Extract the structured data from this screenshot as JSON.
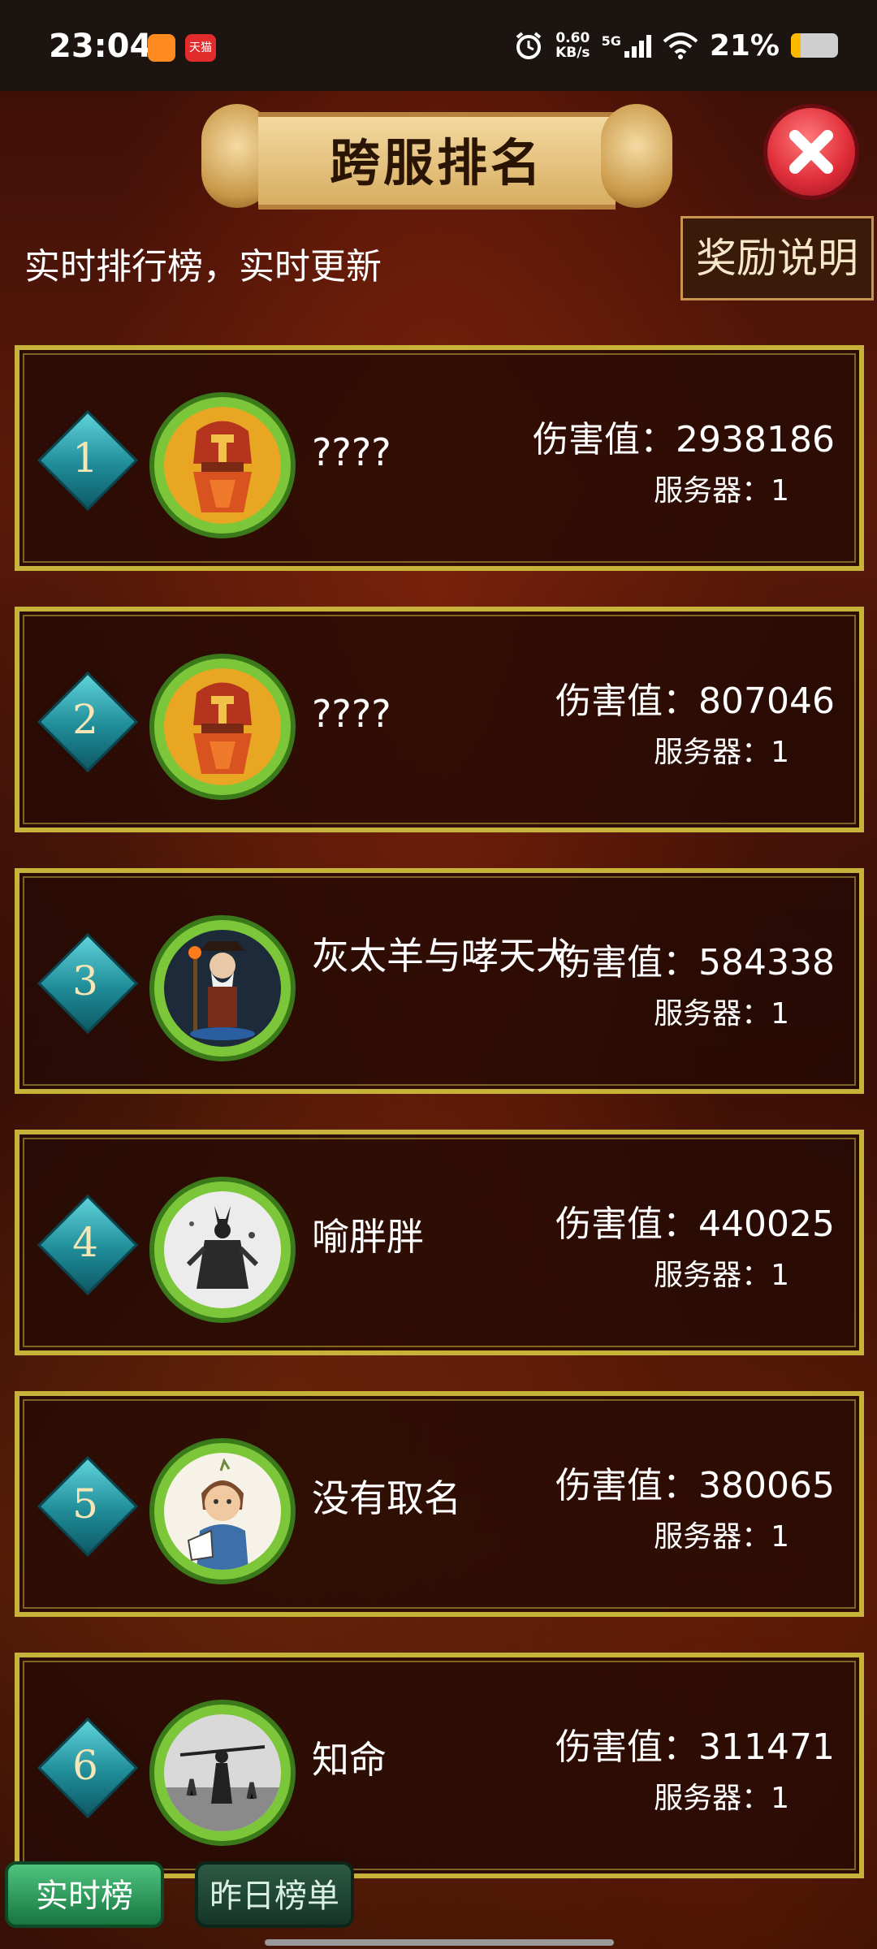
{
  "status_bar": {
    "time": "23:04",
    "app_icons": [
      "app-orange-icon",
      "天猫"
    ],
    "net_speed_top": "0.60",
    "net_speed_bottom": "KB/s",
    "network": "5G",
    "battery": "21%",
    "battery_level": 0.21
  },
  "header": {
    "title": "跨服排名",
    "subtitle": "实时排行榜，实时更新",
    "reward_button": "奖励说明"
  },
  "rows": [
    {
      "rank": "1",
      "name": "????",
      "damage_label": "伤害值：",
      "damage": "2938186",
      "server_label": "服务器：",
      "server": "1",
      "avatar": "dwarf-warrior-avatar"
    },
    {
      "rank": "2",
      "name": "????",
      "damage_label": "伤害值：",
      "damage": "807046",
      "server_label": "服务器：",
      "server": "1",
      "avatar": "dwarf-warrior-avatar"
    },
    {
      "rank": "3",
      "name": "灰太羊与哮天犬",
      "damage_label": "伤害值：",
      "damage": "584338",
      "server_label": "服务器：",
      "server": "1",
      "avatar": "wizard-avatar"
    },
    {
      "rank": "4",
      "name": "喻胖胖",
      "damage_label": "伤害值：",
      "damage": "440025",
      "server_label": "服务器：",
      "server": "1",
      "avatar": "ink-figure-avatar"
    },
    {
      "rank": "5",
      "name": "没有取名",
      "damage_label": "伤害值：",
      "damage": "380065",
      "server_label": "服务器：",
      "server": "1",
      "avatar": "cartoon-lady-avatar"
    },
    {
      "rank": "6",
      "name": "知命",
      "damage_label": "伤害值：",
      "damage": "311471",
      "server_label": "服务器：",
      "server": "1",
      "avatar": "warrior-mist-avatar"
    }
  ],
  "tabs": {
    "realtime": "实时榜",
    "yesterday": "昨日榜单",
    "active": "实时榜"
  },
  "colors": {
    "row_border": "#c7b23a",
    "rank_badge": "#1f8c98",
    "avatar_ring": "#7cc63a",
    "close_button": "#e02f3a"
  }
}
